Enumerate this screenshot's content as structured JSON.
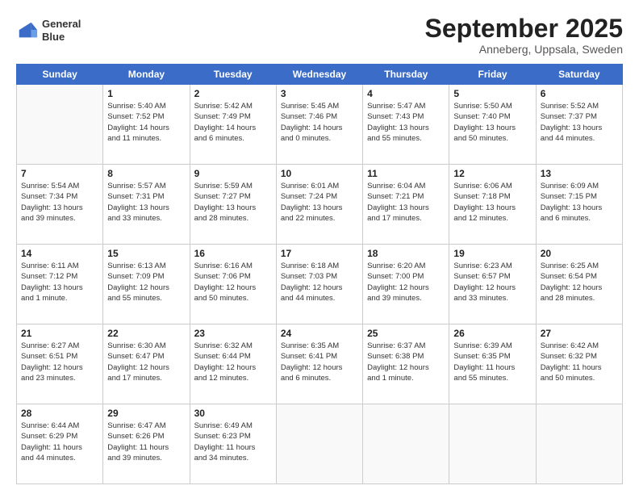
{
  "header": {
    "logo_line1": "General",
    "logo_line2": "Blue",
    "month": "September 2025",
    "location": "Anneberg, Uppsala, Sweden"
  },
  "days_of_week": [
    "Sunday",
    "Monday",
    "Tuesday",
    "Wednesday",
    "Thursday",
    "Friday",
    "Saturday"
  ],
  "weeks": [
    [
      {
        "day": "",
        "info": ""
      },
      {
        "day": "1",
        "info": "Sunrise: 5:40 AM\nSunset: 7:52 PM\nDaylight: 14 hours\nand 11 minutes."
      },
      {
        "day": "2",
        "info": "Sunrise: 5:42 AM\nSunset: 7:49 PM\nDaylight: 14 hours\nand 6 minutes."
      },
      {
        "day": "3",
        "info": "Sunrise: 5:45 AM\nSunset: 7:46 PM\nDaylight: 14 hours\nand 0 minutes."
      },
      {
        "day": "4",
        "info": "Sunrise: 5:47 AM\nSunset: 7:43 PM\nDaylight: 13 hours\nand 55 minutes."
      },
      {
        "day": "5",
        "info": "Sunrise: 5:50 AM\nSunset: 7:40 PM\nDaylight: 13 hours\nand 50 minutes."
      },
      {
        "day": "6",
        "info": "Sunrise: 5:52 AM\nSunset: 7:37 PM\nDaylight: 13 hours\nand 44 minutes."
      }
    ],
    [
      {
        "day": "7",
        "info": "Sunrise: 5:54 AM\nSunset: 7:34 PM\nDaylight: 13 hours\nand 39 minutes."
      },
      {
        "day": "8",
        "info": "Sunrise: 5:57 AM\nSunset: 7:31 PM\nDaylight: 13 hours\nand 33 minutes."
      },
      {
        "day": "9",
        "info": "Sunrise: 5:59 AM\nSunset: 7:27 PM\nDaylight: 13 hours\nand 28 minutes."
      },
      {
        "day": "10",
        "info": "Sunrise: 6:01 AM\nSunset: 7:24 PM\nDaylight: 13 hours\nand 22 minutes."
      },
      {
        "day": "11",
        "info": "Sunrise: 6:04 AM\nSunset: 7:21 PM\nDaylight: 13 hours\nand 17 minutes."
      },
      {
        "day": "12",
        "info": "Sunrise: 6:06 AM\nSunset: 7:18 PM\nDaylight: 13 hours\nand 12 minutes."
      },
      {
        "day": "13",
        "info": "Sunrise: 6:09 AM\nSunset: 7:15 PM\nDaylight: 13 hours\nand 6 minutes."
      }
    ],
    [
      {
        "day": "14",
        "info": "Sunrise: 6:11 AM\nSunset: 7:12 PM\nDaylight: 13 hours\nand 1 minute."
      },
      {
        "day": "15",
        "info": "Sunrise: 6:13 AM\nSunset: 7:09 PM\nDaylight: 12 hours\nand 55 minutes."
      },
      {
        "day": "16",
        "info": "Sunrise: 6:16 AM\nSunset: 7:06 PM\nDaylight: 12 hours\nand 50 minutes."
      },
      {
        "day": "17",
        "info": "Sunrise: 6:18 AM\nSunset: 7:03 PM\nDaylight: 12 hours\nand 44 minutes."
      },
      {
        "day": "18",
        "info": "Sunrise: 6:20 AM\nSunset: 7:00 PM\nDaylight: 12 hours\nand 39 minutes."
      },
      {
        "day": "19",
        "info": "Sunrise: 6:23 AM\nSunset: 6:57 PM\nDaylight: 12 hours\nand 33 minutes."
      },
      {
        "day": "20",
        "info": "Sunrise: 6:25 AM\nSunset: 6:54 PM\nDaylight: 12 hours\nand 28 minutes."
      }
    ],
    [
      {
        "day": "21",
        "info": "Sunrise: 6:27 AM\nSunset: 6:51 PM\nDaylight: 12 hours\nand 23 minutes."
      },
      {
        "day": "22",
        "info": "Sunrise: 6:30 AM\nSunset: 6:47 PM\nDaylight: 12 hours\nand 17 minutes."
      },
      {
        "day": "23",
        "info": "Sunrise: 6:32 AM\nSunset: 6:44 PM\nDaylight: 12 hours\nand 12 minutes."
      },
      {
        "day": "24",
        "info": "Sunrise: 6:35 AM\nSunset: 6:41 PM\nDaylight: 12 hours\nand 6 minutes."
      },
      {
        "day": "25",
        "info": "Sunrise: 6:37 AM\nSunset: 6:38 PM\nDaylight: 12 hours\nand 1 minute."
      },
      {
        "day": "26",
        "info": "Sunrise: 6:39 AM\nSunset: 6:35 PM\nDaylight: 11 hours\nand 55 minutes."
      },
      {
        "day": "27",
        "info": "Sunrise: 6:42 AM\nSunset: 6:32 PM\nDaylight: 11 hours\nand 50 minutes."
      }
    ],
    [
      {
        "day": "28",
        "info": "Sunrise: 6:44 AM\nSunset: 6:29 PM\nDaylight: 11 hours\nand 44 minutes."
      },
      {
        "day": "29",
        "info": "Sunrise: 6:47 AM\nSunset: 6:26 PM\nDaylight: 11 hours\nand 39 minutes."
      },
      {
        "day": "30",
        "info": "Sunrise: 6:49 AM\nSunset: 6:23 PM\nDaylight: 11 hours\nand 34 minutes."
      },
      {
        "day": "",
        "info": ""
      },
      {
        "day": "",
        "info": ""
      },
      {
        "day": "",
        "info": ""
      },
      {
        "day": "",
        "info": ""
      }
    ]
  ]
}
